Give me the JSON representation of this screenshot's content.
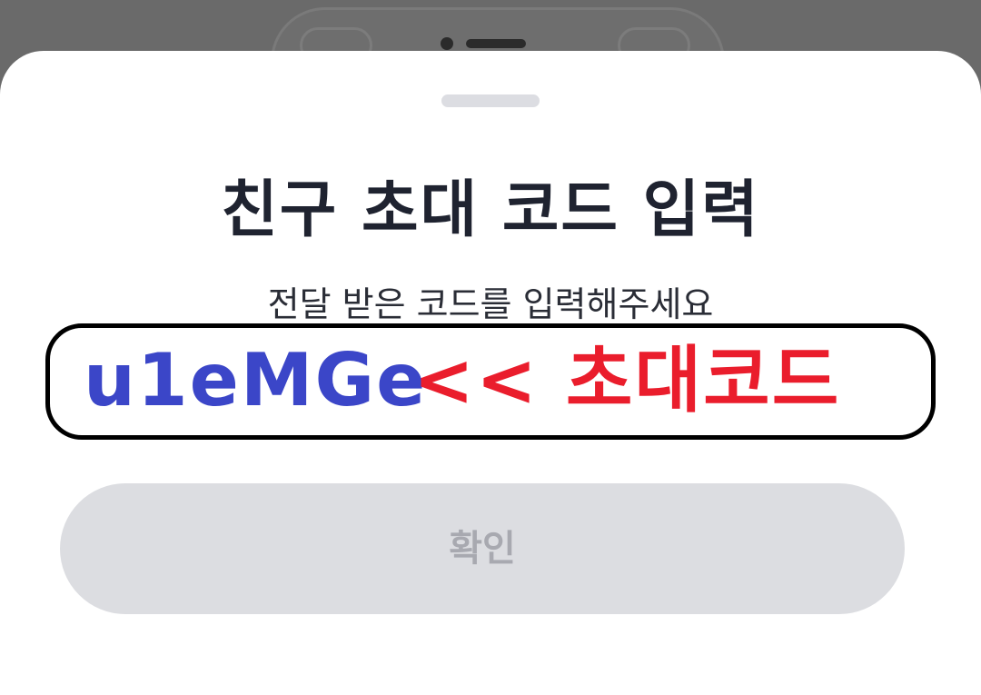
{
  "dialog": {
    "title": "친구 초대 코드 입력",
    "subtitle": "전달 받은 코드를 입력해주세요",
    "code_value": "u1eMGe",
    "code_annotation": "<< 초대코드",
    "confirm_label": "확인"
  },
  "colors": {
    "code_value": "#3b46c8",
    "code_annotation": "#ea1d2c",
    "confirm_bg": "#dcdde1",
    "confirm_text": "#a8a9b0"
  }
}
